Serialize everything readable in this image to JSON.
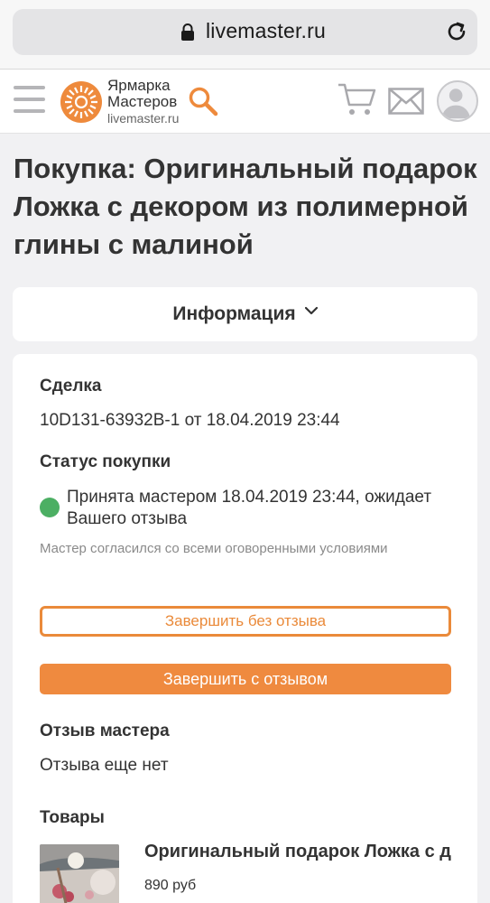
{
  "browser": {
    "url": "livemaster.ru"
  },
  "header": {
    "logo_line1": "Ярмарка",
    "logo_line2": "Мастеров",
    "logo_url": "livemaster.ru"
  },
  "page": {
    "title": "Покупка: Оригинальный подарок Ложка с декором из полимерной глины с малиной",
    "info_toggle": "Информация"
  },
  "deal": {
    "heading": "Сделка",
    "value": "10D131-63932B-1 от 18.04.2019 23:44"
  },
  "status": {
    "heading": "Статус покупки",
    "text": "Принята мастером 18.04.2019 23:44, ожидает Вашего отзыва",
    "note": "Мастер согласился со всеми оговоренными условиями",
    "color": "#4caf63"
  },
  "buttons": {
    "finish_no_review": "Завершить без отзыва",
    "finish_with_review": "Завершить с отзывом"
  },
  "review": {
    "heading": "Отзыв мастера",
    "value": "Отзыва еще нет"
  },
  "products": {
    "heading": "Товары",
    "items": [
      {
        "name": "Оригинальный подарок Ложка с декором из полимерной глины с малиной",
        "price": "890 руб"
      }
    ]
  },
  "colors": {
    "accent": "#ef8a3f",
    "text": "#333333",
    "background": "#f1f1f3"
  },
  "icons": [
    "lock-icon",
    "reload-icon",
    "menu-icon",
    "logo-icon",
    "search-icon",
    "cart-icon",
    "mail-icon",
    "avatar-icon",
    "chevron-down-icon"
  ]
}
